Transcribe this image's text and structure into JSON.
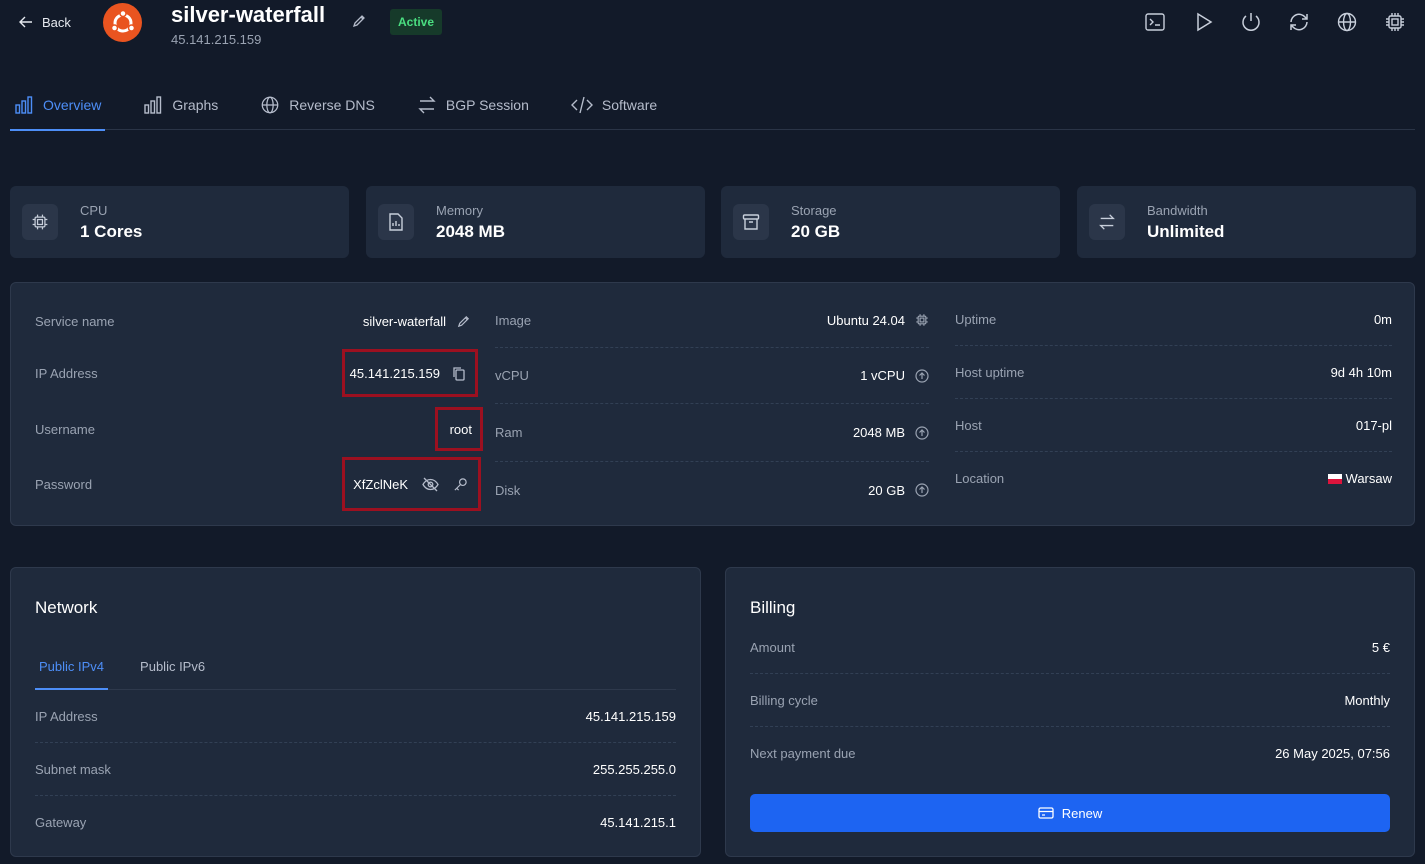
{
  "header": {
    "back_label": "Back",
    "title": "silver-waterfall",
    "ip": "45.141.215.159",
    "status": "Active",
    "status_color": "#4ade80",
    "os_logo_color": "#e95420",
    "actions": [
      "terminal-icon",
      "play-icon",
      "power-icon",
      "refresh-icon",
      "globe-icon",
      "chip-icon"
    ]
  },
  "tabs": [
    {
      "label": "Overview",
      "icon": "bar-chart-icon",
      "active": true
    },
    {
      "label": "Graphs",
      "icon": "bar-chart-icon"
    },
    {
      "label": "Reverse DNS",
      "icon": "globe-icon"
    },
    {
      "label": "BGP Session",
      "icon": "swap-icon"
    },
    {
      "label": "Software",
      "icon": "code-icon"
    }
  ],
  "stats": [
    {
      "label": "CPU",
      "value": "1 Cores",
      "icon": "chip-icon"
    },
    {
      "label": "Memory",
      "value": "2048 MB",
      "icon": "memory-icon"
    },
    {
      "label": "Storage",
      "value": "20 GB",
      "icon": "archive-icon"
    },
    {
      "label": "Bandwidth",
      "value": "Unlimited",
      "icon": "swap-icon"
    }
  ],
  "info": {
    "service_name": {
      "label": "Service name",
      "value": "silver-waterfall"
    },
    "ip_address": {
      "label": "IP Address",
      "value": "45.141.215.159"
    },
    "username": {
      "label": "Username",
      "value": "root"
    },
    "password": {
      "label": "Password",
      "value": "XfZclNeK"
    },
    "image": {
      "label": "Image",
      "value": "Ubuntu 24.04"
    },
    "vcpu": {
      "label": "vCPU",
      "value": "1 vCPU"
    },
    "ram": {
      "label": "Ram",
      "value": "2048 MB"
    },
    "disk": {
      "label": "Disk",
      "value": "20 GB"
    },
    "uptime": {
      "label": "Uptime",
      "value": "0m"
    },
    "host_uptime": {
      "label": "Host uptime",
      "value": "9d 4h 10m"
    },
    "host": {
      "label": "Host",
      "value": "017-pl"
    },
    "location": {
      "label": "Location",
      "value": "Warsaw"
    }
  },
  "network": {
    "title": "Network",
    "tabs": [
      {
        "label": "Public IPv4",
        "active": true
      },
      {
        "label": "Public IPv6"
      }
    ],
    "rows": [
      {
        "label": "IP Address",
        "value": "45.141.215.159"
      },
      {
        "label": "Subnet mask",
        "value": "255.255.255.0"
      },
      {
        "label": "Gateway",
        "value": "45.141.215.1"
      }
    ]
  },
  "billing": {
    "title": "Billing",
    "rows": [
      {
        "label": "Amount",
        "value": "5 €"
      },
      {
        "label": "Billing cycle",
        "value": "Monthly"
      },
      {
        "label": "Next payment due",
        "value": "26 May 2025, 07:56"
      }
    ],
    "renew_label": "Renew",
    "accent": "#1d64f2"
  }
}
